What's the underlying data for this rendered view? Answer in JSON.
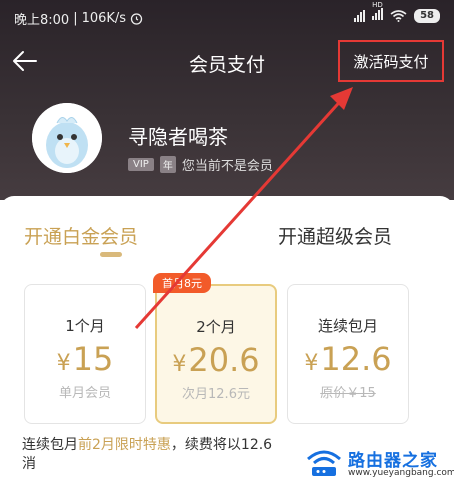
{
  "status_bar": {
    "time": "晚上8:00",
    "speed": "106K/s",
    "hd_label": "HD",
    "battery": "58"
  },
  "header": {
    "title": "会员支付",
    "code_pay_label": "激活码支付"
  },
  "user": {
    "name": "寻隐者喝茶",
    "vip_tag": "VIP",
    "year_tag": "年",
    "status_text": "您当前不是会员"
  },
  "tabs": [
    {
      "label": "开通白金会员",
      "active": true
    },
    {
      "label": "开通超级会员",
      "active": false
    }
  ],
  "plans": [
    {
      "name": "1个月",
      "currency": "¥",
      "price": "15",
      "sub": "单月会员",
      "strike": false,
      "selected": false
    },
    {
      "name": "2个月",
      "currency": "¥",
      "price": "20.6",
      "sub": "次月12.6元",
      "strike": false,
      "selected": true,
      "badge": "首月8元"
    },
    {
      "name": "连续包月",
      "currency": "¥",
      "price": "12.6",
      "sub": "原价￥15",
      "strike": true,
      "selected": false
    }
  ],
  "note": {
    "prefix": "连续包月",
    "highlight": "前2月限时特惠",
    "suffix": "，续费将以12.6",
    "line2": "消"
  },
  "watermark": {
    "text": "路由器之家",
    "url": "www.yueyangbang.com"
  },
  "colors": {
    "header_bg": "#2a2329",
    "gold": "#c9a154",
    "annotation_red": "#e53935",
    "badge": "#f25b2a"
  }
}
